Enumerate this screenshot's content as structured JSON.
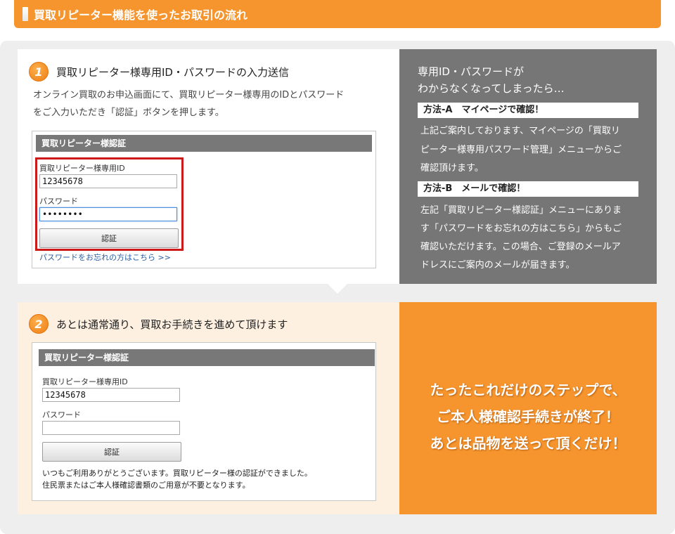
{
  "header": {
    "title": "買取リピーター機能を使ったお取引の流れ"
  },
  "step1": {
    "number": "1",
    "title": "買取リピーター様専用ID・パスワードの入力送信",
    "desc_line1": "オンライン買取のお申込画面にて、買取リピーター様専用のIDとパスワード",
    "desc_line2": "をご入力いただき「認証」ボタンを押します。",
    "auth": {
      "heading": "買取リピーター様認証",
      "id_label": "買取リピーター様専用ID",
      "id_value": "12345678",
      "pw_label": "パスワード",
      "pw_value": "••••••••",
      "button": "認証",
      "forgot_link": "パスワードをお忘れの方はこちら >>"
    }
  },
  "help": {
    "title_line1": "専用ID・パスワードが",
    "title_line2": "わからなくなってしまったら…",
    "method_a": {
      "label": "方法-A　マイページで確認！",
      "line1": "上記ご案内しております、マイページの「買取リ",
      "line2": "ピーター様専用パスワード管理」メニューからご",
      "line3": "確認頂けます。"
    },
    "method_b": {
      "label": "方法-B　メールで確認！",
      "line1": "左記「買取リピーター様認証」メニューにありま",
      "line2": "す「パスワードをお忘れの方はこちら」からもご",
      "line3": "確認いただけます。この場合、ご登録のメールア",
      "line4": "ドレスにご案内のメールが届きます。"
    }
  },
  "step2": {
    "number": "2",
    "title": "あとは通常通り、買取お手続きを進めて頂けます",
    "auth": {
      "heading": "買取リピーター様認証",
      "id_label": "買取リピーター様専用ID",
      "id_value": "12345678",
      "pw_label": "パスワード",
      "pw_value": "",
      "button": "認証",
      "complete_line1": "いつもご利用ありがとうございます。買取リピーター様の認証ができました。",
      "complete_line2": "住民票またはご本人様確認書類のご用意が不要となります。"
    }
  },
  "final": {
    "line1": "たったこれだけのステップで、",
    "line2": "ご本人様確認手続きが終了！",
    "line3": "あとは品物を送って頂くだけ！"
  }
}
